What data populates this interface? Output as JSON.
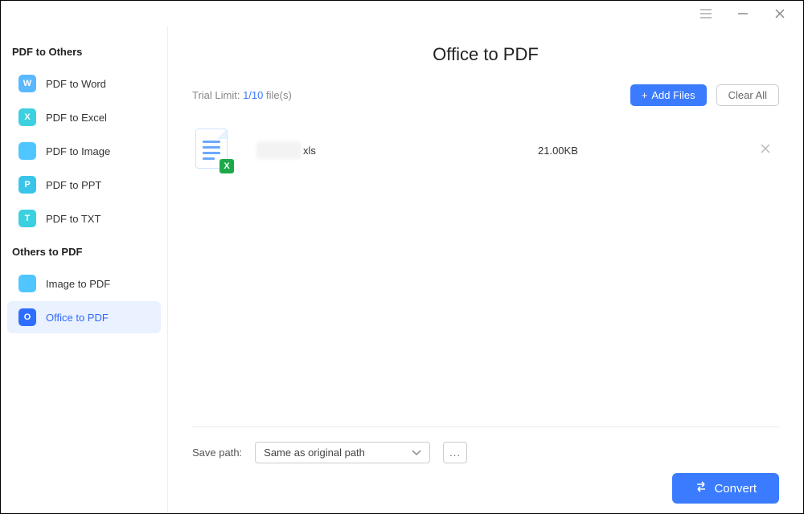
{
  "sidebar": {
    "section1_title": "PDF to Others",
    "section2_title": "Others to PDF",
    "items1": [
      {
        "label": "PDF to Word",
        "badge": "W",
        "color": "#5ab8ff"
      },
      {
        "label": "PDF to Excel",
        "badge": "X",
        "color": "#3dd0e0"
      },
      {
        "label": "PDF to Image",
        "badge": "",
        "color": "#4fc6ff"
      },
      {
        "label": "PDF to PPT",
        "badge": "P",
        "color": "#3bc4ea"
      },
      {
        "label": "PDF to TXT",
        "badge": "T",
        "color": "#3bd0e0"
      }
    ],
    "items2": [
      {
        "label": "Image to PDF",
        "badge": "",
        "color": "#4fc6ff",
        "selected": false
      },
      {
        "label": "Office to PDF",
        "badge": "O",
        "color": "#2f6dff",
        "selected": true
      }
    ]
  },
  "page": {
    "title": "Office to PDF",
    "trial_label_prefix": "Trial Limit: ",
    "trial_count": "1/10",
    "trial_suffix": " file(s)",
    "add_files_label": "Add Files",
    "clear_all_label": "Clear All"
  },
  "file": {
    "ext": "xls",
    "size": "21.00KB",
    "icon_badge": "X"
  },
  "footer": {
    "save_path_label": "Save path:",
    "save_path_value": "Same as original path",
    "browse_label": "...",
    "convert_label": "Convert"
  }
}
